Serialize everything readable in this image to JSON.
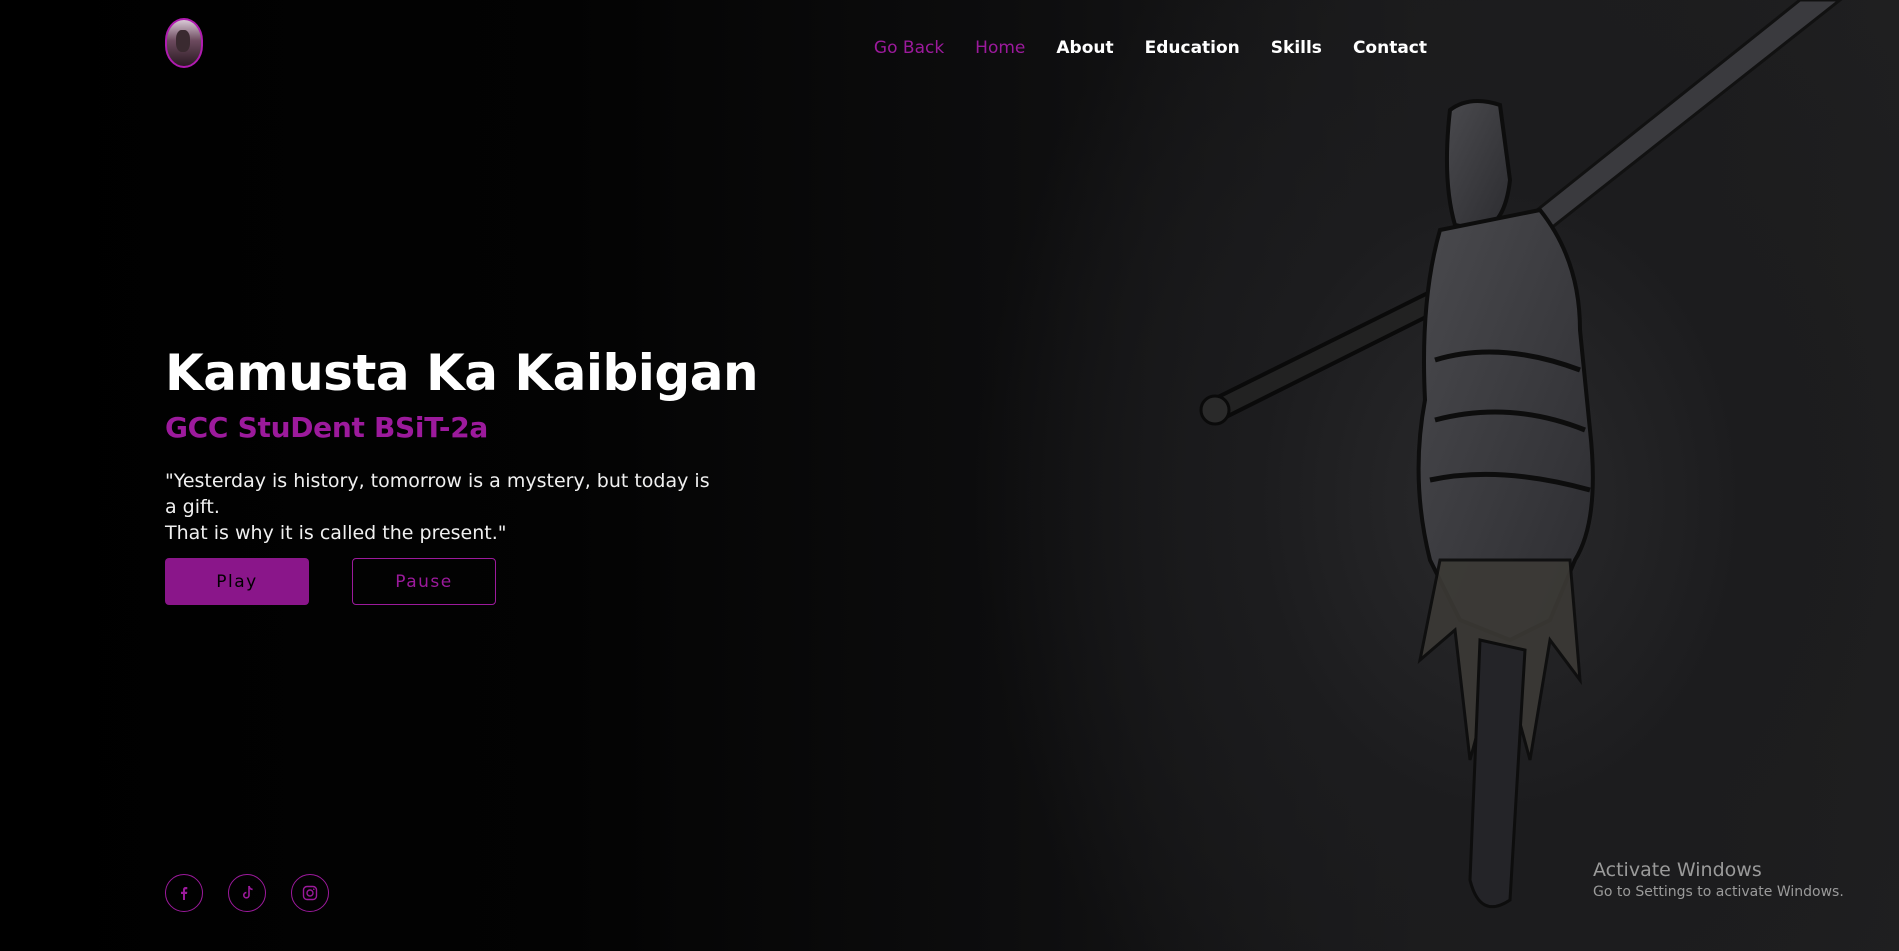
{
  "nav": {
    "items": [
      {
        "label": "Go Back"
      },
      {
        "label": "Home"
      },
      {
        "label": "About"
      },
      {
        "label": "Education"
      },
      {
        "label": "Skills"
      },
      {
        "label": "Contact"
      }
    ]
  },
  "hero": {
    "title": "Kamusta Ka Kaibigan",
    "subtitle": "GCC StuDent BSiT-2a",
    "quote_line1": "\"Yesterday is history, tomorrow is a mystery, but today is a gift.",
    "quote_line2": "That is why it is called the present.\""
  },
  "buttons": {
    "play": "Play",
    "pause": "Pause"
  },
  "social": {
    "icons": [
      "facebook-icon",
      "tiktok-icon",
      "instagram-icon"
    ]
  },
  "windows_watermark": {
    "title": "Activate Windows",
    "subtitle": "Go to Settings to activate Windows."
  },
  "colors": {
    "accent": "#9c1a9c",
    "background": "#000000",
    "text": "#ffffff"
  }
}
